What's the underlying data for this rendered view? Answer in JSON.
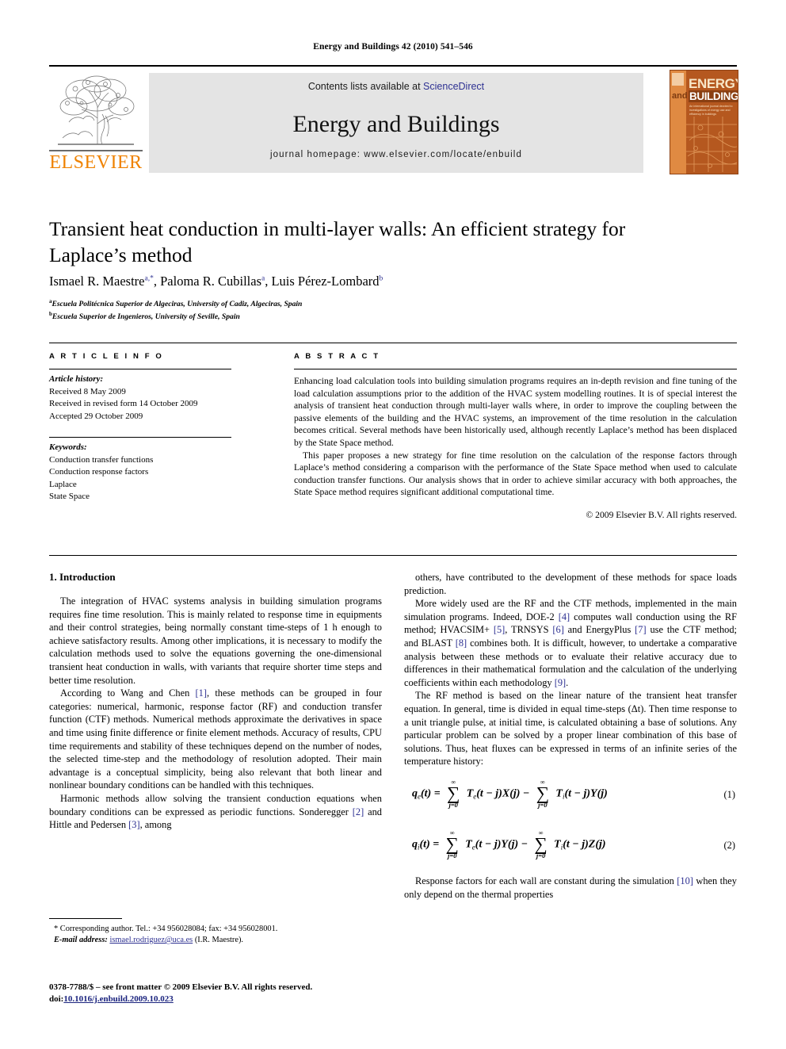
{
  "running_head": "Energy and Buildings 42 (2010) 541–546",
  "masthead": {
    "contents_prefix": "Contents lists available at ",
    "sciencedirect": "ScienceDirect",
    "journal_title": "Energy and Buildings",
    "homepage": "journal homepage: www.elsevier.com/locate/enbuild",
    "publisher_wordmark": "ELSEVIER",
    "cover": {
      "line1": "ENERGY",
      "line2": "and",
      "line3": "BUILDINGS",
      "subtitle": "An international journal devoted to investigations of energy use and efficiency in buildings"
    },
    "link_color": "#2e3192",
    "brand_orange": "#ef8200"
  },
  "article": {
    "title": "Transient heat conduction in multi-layer walls: An efficient strategy for Laplace’s method",
    "authors": [
      {
        "name": "Ismael R. Maestre",
        "marks": "a,*"
      },
      {
        "name": "Paloma R. Cubillas",
        "marks": "a"
      },
      {
        "name": "Luis Pérez-Lombard",
        "marks": "b"
      }
    ],
    "affiliations": [
      {
        "mark": "a",
        "text": "Escuela Politécnica Superior de Algeciras, University of Cadiz, Algeciras, Spain"
      },
      {
        "mark": "b",
        "text": "Escuela Superior de Ingenieros, University of Seville, Spain"
      }
    ]
  },
  "info": {
    "heading": "A R T I C L E   I N F O",
    "history_label": "Article history:",
    "history": [
      "Received 8 May 2009",
      "Received in revised form 14 October 2009",
      "Accepted 29 October 2009"
    ],
    "keywords_label": "Keywords:",
    "keywords": [
      "Conduction transfer functions",
      "Conduction response factors",
      "Laplace",
      "State Space"
    ]
  },
  "abstract": {
    "heading": "A B S T R A C T",
    "paragraph1": "Enhancing load calculation tools into building simulation programs requires an in-depth revision and fine tuning of the load calculation assumptions prior to the addition of the HVAC system modelling routines. It is of special interest the analysis of transient heat conduction through multi-layer walls where, in order to improve the coupling between the passive elements of the building and the HVAC systems, an improvement of the time resolution in the calculation becomes critical. Several methods have been historically used, although recently Laplace’s method has been displaced by the State Space method.",
    "paragraph2": "This paper proposes a new strategy for fine time resolution on the calculation of the response factors through Laplace’s method considering a comparison with the performance of the State Space method when used to calculate conduction transfer functions. Our analysis shows that in order to achieve similar accuracy with both approaches, the State Space method requires significant additional computational time.",
    "copyright": "© 2009 Elsevier B.V. All rights reserved."
  },
  "body": {
    "section1_heading": "1. Introduction",
    "left_paragraphs": [
      "The integration of HVAC systems analysis in building simulation programs requires fine time resolution. This is mainly related to response time in equipments and their control strategies, being normally constant time-steps of 1 h enough to achieve satisfactory results. Among other implications, it is necessary to modify the calculation methods used to solve the equations governing the one-dimensional transient heat conduction in walls, with variants that require shorter time steps and better time resolution.",
      "According to Wang and Chen [1], these methods can be grouped in four categories: numerical, harmonic, response factor (RF) and conduction transfer function (CTF) methods. Numerical methods approximate the derivatives in space and time using finite difference or finite element methods. Accuracy of results, CPU time requirements and stability of these techniques depend on the number of nodes, the selected time-step and the methodology of resolution adopted. Their main advantage is a conceptual simplicity, being also relevant that both linear and nonlinear boundary conditions can be handled with this techniques.",
      "Harmonic methods allow solving the transient conduction equations when boundary conditions can be expressed as periodic functions. Sonderegger [2] and Hittle and Pedersen [3], among"
    ],
    "right_paragraphs": [
      "others, have contributed to the development of these methods for space loads prediction.",
      "More widely used are the RF and the CTF methods, implemented in the main simulation programs. Indeed, DOE-2 [4] computes wall conduction using the RF method; HVACSIM+ [5], TRNSYS [6] and EnergyPlus [7] use the CTF method; and BLAST [8] combines both. It is difficult, however, to undertake a comparative analysis between these methods or to evaluate their relative accuracy due to differences in their mathematical formulation and the calculation of the underlying coefficients within each methodology [9].",
      "The RF method is based on the linear nature of the transient heat transfer equation. In general, time is divided in equal time-steps (Δt). Then time response to a unit triangle pulse, at initial time, is calculated obtaining a base of solutions. Any particular problem can be solved by a proper linear combination of this base of solutions. Thus, heat fluxes can be expressed in terms of an infinite series of the temperature history:"
    ],
    "right_paragraph_after_equations": "Response factors for each wall are constant during the simulation [10] when they only depend on the thermal properties"
  },
  "equations": [
    {
      "number": "(1)",
      "lhs": "q",
      "lhs_sub": "e",
      "lhs_arg": "(t) =",
      "term1": "T",
      "term1_sub": "e",
      "term1_rest": "(t − j)X(j) −",
      "term2": "T",
      "term2_sub": "i",
      "term2_rest": "(t − j)Y(j)",
      "sum_upper": "∞",
      "sum_lower": "j=0"
    },
    {
      "number": "(2)",
      "lhs": "q",
      "lhs_sub": "i",
      "lhs_arg": "(t) =",
      "term1": "T",
      "term1_sub": "e",
      "term1_rest": "(t − j)Y(j) −",
      "term2": "T",
      "term2_sub": "i",
      "term2_rest": "(t − j)Z(j)",
      "sum_upper": "∞",
      "sum_lower": "j=0"
    }
  ],
  "footnote": {
    "corresponding": "* Corresponding author. Tel.: +34 956028084; fax: +34 956028001.",
    "email_label": "E-mail address:",
    "email": "ismael.rodriguez@uca.es",
    "email_owner": "(I.R. Maestre)."
  },
  "page_footer": {
    "issn_line": "0378-7788/$ – see front matter © 2009 Elsevier B.V. All rights reserved.",
    "doi_label": "doi:",
    "doi": "10.1016/j.enbuild.2009.10.023"
  }
}
